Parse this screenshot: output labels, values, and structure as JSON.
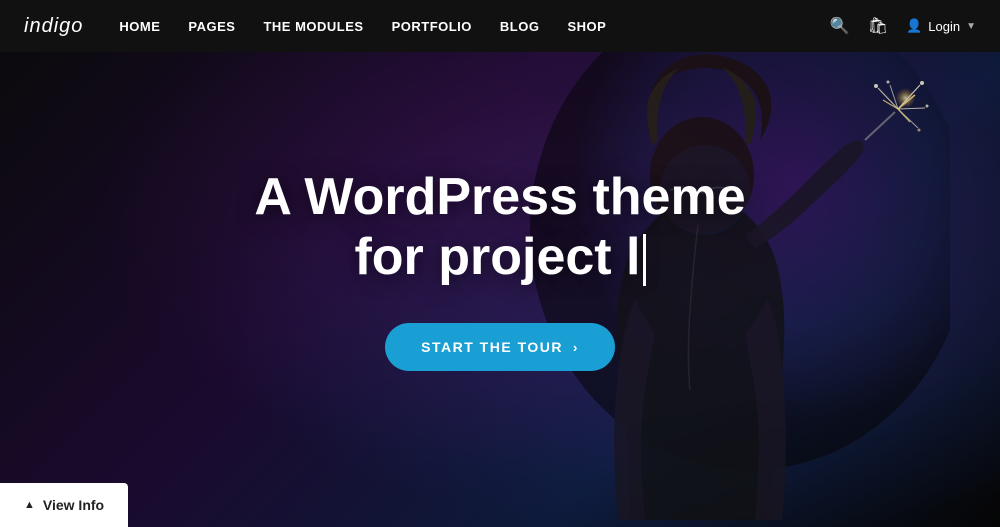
{
  "navbar": {
    "logo": "indigo",
    "nav_items": [
      {
        "label": "HOME"
      },
      {
        "label": "PAGES"
      },
      {
        "label": "THE MODULES"
      },
      {
        "label": "PORTFOLIO"
      },
      {
        "label": "BLOG"
      },
      {
        "label": "SHOP"
      }
    ],
    "login_label": "Login",
    "colors": {
      "bg": "#111111"
    }
  },
  "hero": {
    "title_line1": "A WordPress theme",
    "title_line2": "for project l",
    "cta_label": "START THE TOUR",
    "cta_arrow": "›",
    "colors": {
      "cta_bg": "#1a9fd4"
    }
  },
  "view_info": {
    "label": "View Info",
    "chevron": "^"
  }
}
